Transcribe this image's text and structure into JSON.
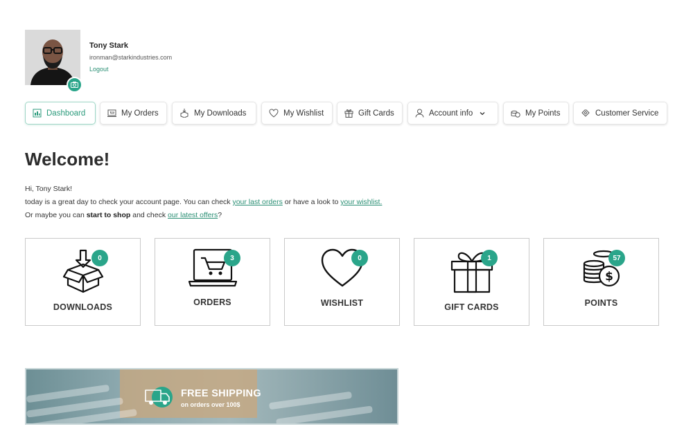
{
  "user": {
    "name": "Tony Stark",
    "email": "ironman@starkindustries.com",
    "logout_label": "Logout"
  },
  "nav": {
    "tabs": [
      {
        "label": "Dashboard",
        "icon": "dashboard-icon",
        "active": true
      },
      {
        "label": "My Orders",
        "icon": "orders-icon"
      },
      {
        "label": "My Downloads",
        "icon": "downloads-icon"
      },
      {
        "label": "My Wishlist",
        "icon": "heart-icon"
      },
      {
        "label": "Gift Cards",
        "icon": "gift-icon"
      },
      {
        "label": "Account info",
        "icon": "user-icon",
        "has_dropdown": true
      },
      {
        "label": "My Points",
        "icon": "points-icon"
      },
      {
        "label": "Customer Service",
        "icon": "support-icon"
      }
    ]
  },
  "welcome": {
    "title": "Welcome!",
    "line1": "Hi, Tony Stark!",
    "line2_pre": "today is a great day to check your account page. You can check ",
    "line2_link1": "your last orders",
    "line2_mid": " or have a look to ",
    "line2_link2": "your wishlist.",
    "line3_pre": "Or maybe you can ",
    "line3_bold": "start to shop",
    "line3_mid": " and check ",
    "line3_link": "our latest offers",
    "line3_post": "?"
  },
  "cards": [
    {
      "label": "DOWNLOADS",
      "count": "0",
      "icon": "download-box-icon"
    },
    {
      "label": "ORDERS",
      "count": "3",
      "icon": "laptop-cart-icon"
    },
    {
      "label": "WISHLIST",
      "count": "0",
      "icon": "heart-icon"
    },
    {
      "label": "GIFT CARDS",
      "count": "1",
      "icon": "gift-box-icon"
    },
    {
      "label": "POINTS",
      "count": "57",
      "icon": "coins-icon"
    }
  ],
  "banner": {
    "title": "FREE SHIPPING",
    "subtitle": "on orders over 100$"
  },
  "colors": {
    "accent": "#2aa58a",
    "link": "#2a8f74"
  }
}
